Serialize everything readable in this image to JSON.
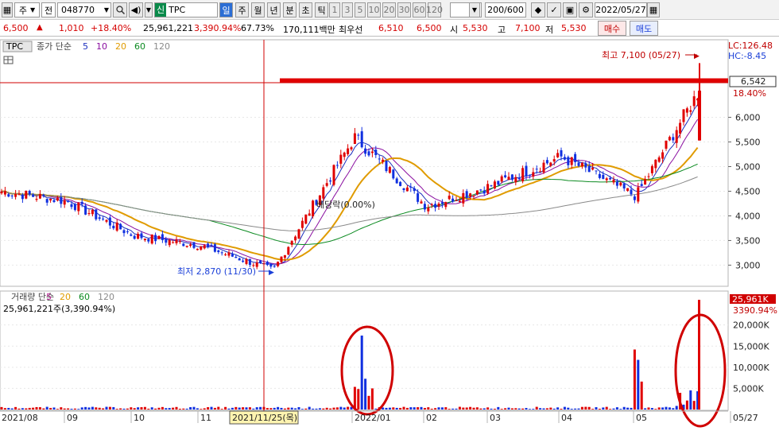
{
  "toolbar": {
    "market": "주",
    "prev_label": "전",
    "code": "048770",
    "badge": "신",
    "stock_name": "TPC",
    "periods": [
      "일",
      "주",
      "월",
      "년",
      "분",
      "초",
      "틱"
    ],
    "intervals": [
      "1",
      "3",
      "5",
      "10",
      "20",
      "30",
      "60",
      "120"
    ],
    "count": "200/600",
    "date": "2022/05/27"
  },
  "quote": {
    "price": "6,500",
    "change": "1,010",
    "change_pct": "+18.40%",
    "volume": "25,961,221",
    "volume_ratio": "3,390.94%",
    "turnover": "67.73%",
    "amount": "170,111백만",
    "best_label": "최우선",
    "best_ask": "6,510",
    "best_bid": "6,500",
    "open_label": "시",
    "open": "5,530",
    "high_label": "고",
    "high": "7,100",
    "low_label": "저",
    "low": "5,530",
    "buy_label": "매수",
    "sell_label": "매도"
  },
  "price_panel": {
    "tab": "TPC",
    "legend_title": "종가 단순",
    "ma": [
      {
        "label": "5",
        "color": "#1c2fbf"
      },
      {
        "label": "10",
        "color": "#8a0fa0"
      },
      {
        "label": "20",
        "color": "#e09b00"
      },
      {
        "label": "60",
        "color": "#0b8a20"
      },
      {
        "label": "120",
        "color": "#8a8a8a"
      }
    ],
    "lc": "LC:126.48",
    "hc": "HC:-8.45",
    "current_price": "6,542",
    "current_pct": "18.40%",
    "high_annotation": "최고 7,100 (05/27)",
    "low_annotation": "최저 2,870 (11/30)",
    "dividend_annotation": "배당락(0.00%)",
    "y_ticks": [
      "6,000",
      "5,500",
      "5,000",
      "4,500",
      "4,000",
      "3,500",
      "3,000"
    ]
  },
  "volume_panel": {
    "title": "거래량 단순",
    "ma": [
      {
        "label": "5",
        "color": "#c0289c"
      },
      {
        "label": "20",
        "color": "#e09b00"
      },
      {
        "label": "60",
        "color": "#0b8a20"
      },
      {
        "label": "120",
        "color": "#8a8a8a"
      }
    ],
    "stats": "25,961,221주(3,390.94%)",
    "current_volume": "25,961K",
    "current_pct": "3390.94%",
    "y_ticks": [
      "20,000K",
      "15,000K",
      "10,000K",
      "5,000K"
    ]
  },
  "x_axis": {
    "labels": [
      "2021/08",
      "09",
      "10",
      "11",
      "2022/01",
      "02",
      "03",
      "04",
      "05",
      "05/27"
    ],
    "crosshair_date": "2021/11/25(목)"
  },
  "chart_data": {
    "type": "candlestick",
    "symbol": "TPC",
    "y_range": [
      2700,
      7300
    ],
    "volume_range_k": [
      0,
      25961
    ],
    "close_series": [
      {
        "x": "2021/08",
        "y": 4500
      },
      {
        "x": "09",
        "y": 4300
      },
      {
        "x": "10",
        "y": 3600
      },
      {
        "x": "11",
        "y": 3400
      },
      {
        "x": "11/30",
        "y": 2900
      },
      {
        "x": "2022/01",
        "y": 5600
      },
      {
        "x": "02",
        "y": 4200
      },
      {
        "x": "03",
        "y": 4600
      },
      {
        "x": "04",
        "y": 5200
      },
      {
        "x": "05",
        "y": 4400
      },
      {
        "x": "05/27",
        "y": 6500
      }
    ],
    "high": {
      "date": "05/27",
      "value": 7100
    },
    "low": {
      "date": "11/30",
      "value": 2870
    }
  }
}
